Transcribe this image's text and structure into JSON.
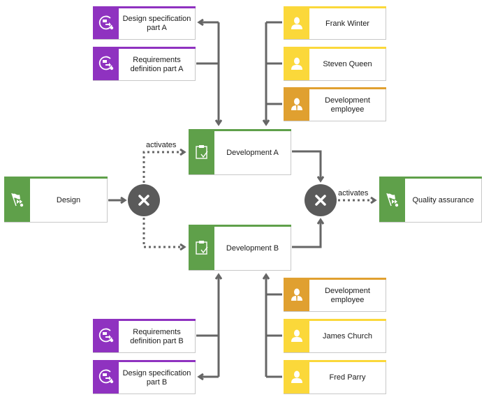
{
  "colors": {
    "function": "#5fa04a",
    "document": "#8f32c0",
    "person": "#fbd83a",
    "role": "#e0a030",
    "connector": "#666666",
    "gateway": "#5a5a5a"
  },
  "events": {
    "design": {
      "label": "Design",
      "icon": "flag-start-icon"
    },
    "quality_assurance": {
      "label": "Quality assurance",
      "icon": "flag-start-icon"
    }
  },
  "functions": {
    "dev_a": {
      "label": "Development A",
      "icon": "clipboard-check-icon"
    },
    "dev_b": {
      "label": "Development B",
      "icon": "clipboard-check-icon"
    }
  },
  "gateways": {
    "split": {
      "type": "XOR",
      "icon": "x-icon"
    },
    "join": {
      "type": "XOR",
      "icon": "x-icon"
    }
  },
  "edge_labels": {
    "split_to_dev_a": "activates",
    "join_to_qa": "activates"
  },
  "documents": {
    "design_spec_a": {
      "label": "Design specification part A",
      "icon": "process-flow-icon"
    },
    "req_def_a": {
      "label": "Requirements definition part A",
      "icon": "process-flow-icon"
    },
    "req_def_b": {
      "label": "Requirements definition part B",
      "icon": "process-flow-icon"
    },
    "design_spec_b": {
      "label": "Design specification part B",
      "icon": "process-flow-icon"
    }
  },
  "people": {
    "frank": {
      "label": "Frank Winter",
      "icon": "person-icon"
    },
    "steven": {
      "label": "Steven Queen",
      "icon": "person-icon"
    },
    "dev_emp_top": {
      "label": "Development employee",
      "icon": "employee-role-icon"
    },
    "dev_emp_bottom": {
      "label": "Development employee",
      "icon": "employee-role-icon"
    },
    "james": {
      "label": "James Church",
      "icon": "person-icon"
    },
    "fred": {
      "label": "Fred Parry",
      "icon": "person-icon"
    }
  }
}
